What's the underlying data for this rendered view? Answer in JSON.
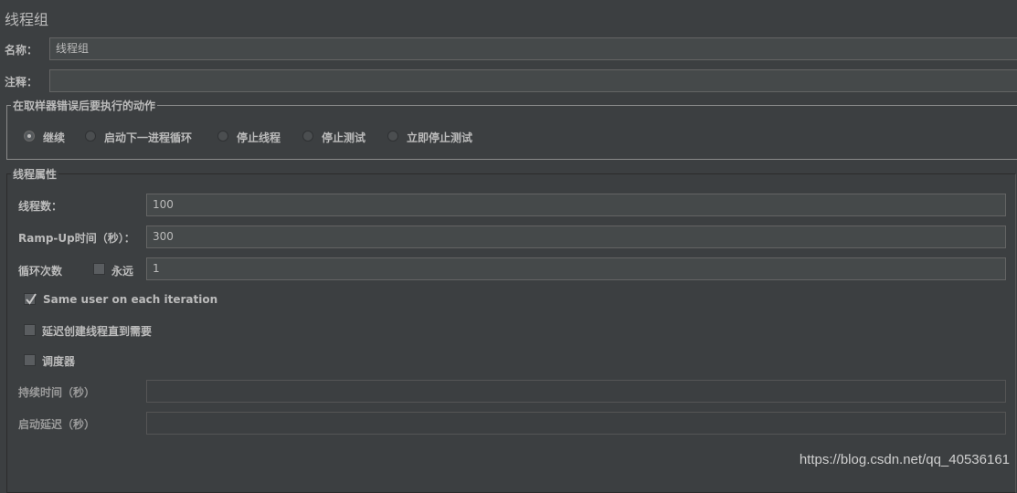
{
  "title": "线程组",
  "name_field": {
    "label": "名称：",
    "value": "线程组"
  },
  "comment_field": {
    "label": "注释：",
    "value": ""
  },
  "error_action": {
    "legend": "在取样器错误后要执行的动作",
    "options": [
      {
        "label": "继续",
        "selected": true
      },
      {
        "label": "启动下一进程循环",
        "selected": false
      },
      {
        "label": "停止线程",
        "selected": false
      },
      {
        "label": "停止测试",
        "selected": false
      },
      {
        "label": "立即停止测试",
        "selected": false
      }
    ]
  },
  "thread_props": {
    "legend": "线程属性",
    "num_threads": {
      "label": "线程数：",
      "value": "100"
    },
    "ramp_up": {
      "label": "Ramp-Up时间（秒）：",
      "value": "300"
    },
    "loop_count": {
      "label": "循环次数",
      "forever_label": "永远",
      "forever_checked": false,
      "value": "1"
    },
    "same_user": {
      "label": "Same user on each iteration",
      "checked": true
    },
    "delay_create": {
      "label": "延迟创建线程直到需要",
      "checked": false
    },
    "scheduler": {
      "label": "调度器",
      "checked": false
    },
    "duration": {
      "label": "持续时间（秒）",
      "value": ""
    },
    "startup_delay": {
      "label": "启动延迟（秒）",
      "value": ""
    }
  },
  "watermark": "https://blog.csdn.net/qq_40536161"
}
